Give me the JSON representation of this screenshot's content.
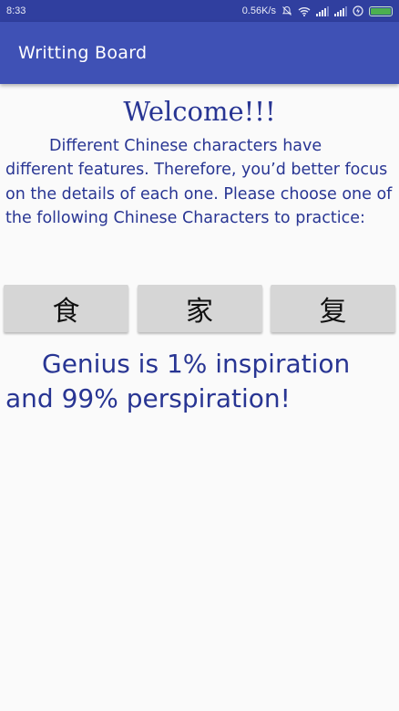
{
  "status_bar": {
    "time": "8:33",
    "net_speed": "0.56K/s",
    "icons": [
      "alarm-off-icon",
      "wifi-icon",
      "signal-icon",
      "signal-icon",
      "charging-icon",
      "battery-icon"
    ],
    "battery_level": 1.0,
    "battery_color": "#4caf50"
  },
  "app_bar": {
    "title": "Writting Board",
    "color": "#3f51b5"
  },
  "main": {
    "welcome": "Welcome!!!",
    "intro": "Different Chinese characters have different features. Therefore, you’d better focus on the details of each one. Please choose one of the following Chinese Characters to practice:",
    "characters": [
      "食",
      "家",
      "复"
    ],
    "quote": "Genius is 1% inspiration and 99% perspiration!",
    "text_color": "#283593"
  }
}
